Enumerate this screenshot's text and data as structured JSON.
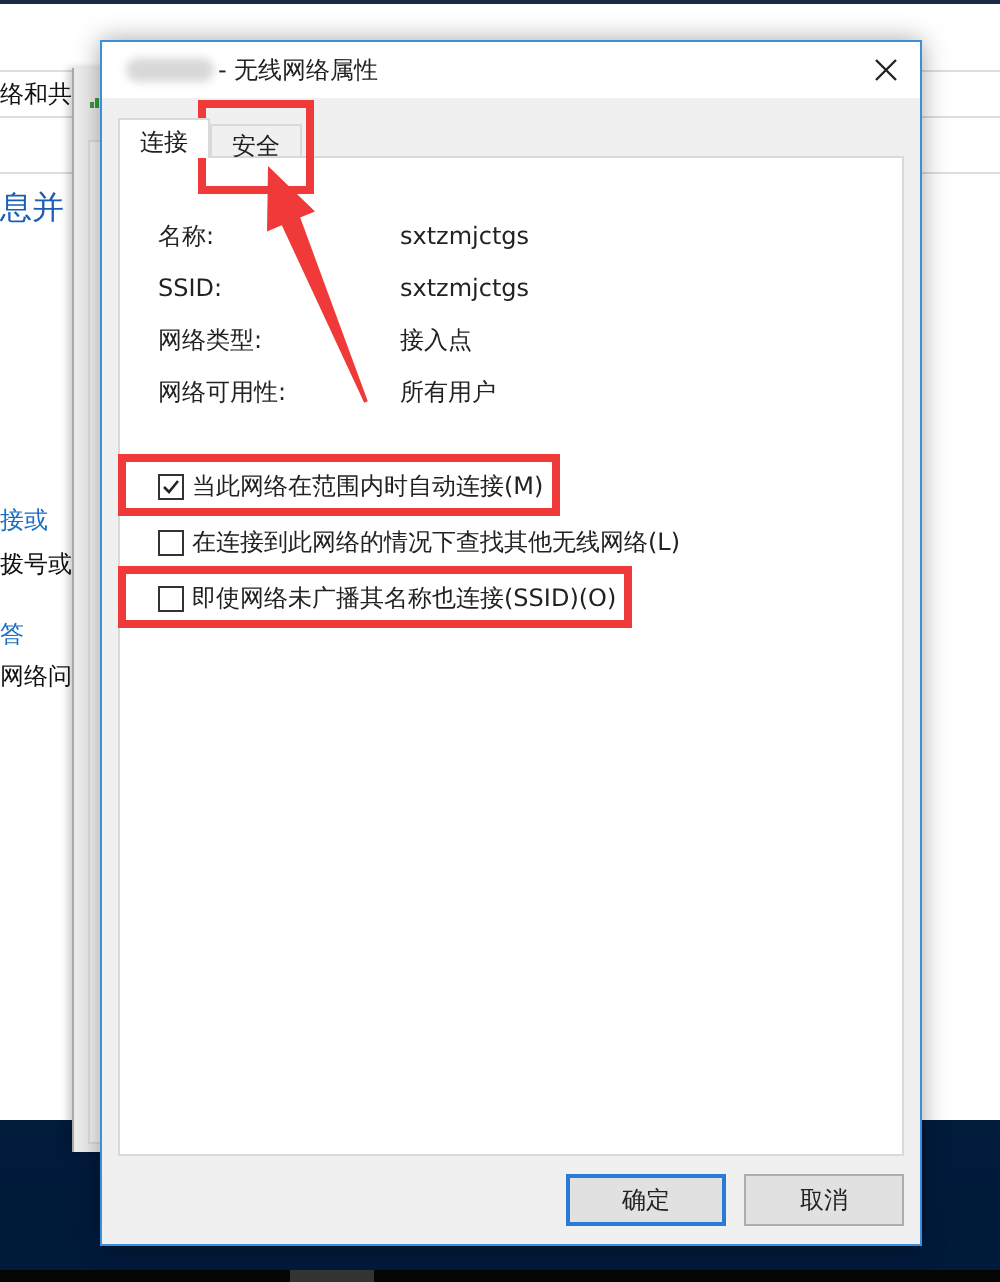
{
  "background_window": {
    "texts": [
      {
        "kind": "title",
        "text": "络和共"
      },
      {
        "kind": "heading",
        "text": "息并"
      },
      {
        "kind": "link",
        "text": "接或"
      },
      {
        "kind": "text",
        "text": "拨号或"
      },
      {
        "kind": "link",
        "text": "答"
      },
      {
        "kind": "text",
        "text": "网络问"
      }
    ]
  },
  "dialog": {
    "title": "- 无线网络属性",
    "title_redacted": true,
    "tabs": [
      {
        "label": "连接",
        "selected": true,
        "highlighted": false,
        "pointed_at": false
      },
      {
        "label": "安全",
        "selected": false,
        "highlighted": true,
        "pointed_at": true
      }
    ],
    "properties": [
      {
        "label": "名称:",
        "value": "sxtzmjctgs"
      },
      {
        "label": "SSID:",
        "value": "sxtzmjctgs"
      },
      {
        "label": "网络类型:",
        "value": "接入点"
      },
      {
        "label": "网络可用性:",
        "value": "所有用户"
      }
    ],
    "checkboxes": [
      {
        "label": "当此网络在范围内时自动连接(M)",
        "checked": true,
        "highlighted": true
      },
      {
        "label": "在连接到此网络的情况下查找其他无线网络(L)",
        "checked": false,
        "highlighted": false
      },
      {
        "label": "即使网络未广播其名称也连接(SSID)(O)",
        "checked": false,
        "highlighted": true
      }
    ],
    "buttons": [
      {
        "label": "确定",
        "default": true
      },
      {
        "label": "取消",
        "default": false
      }
    ]
  }
}
